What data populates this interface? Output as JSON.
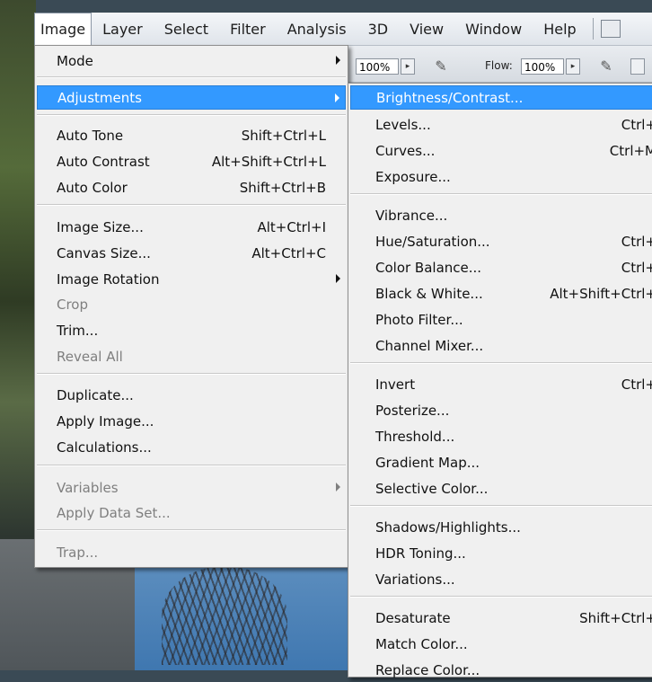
{
  "menubar": {
    "items": [
      "Image",
      "Layer",
      "Select",
      "Filter",
      "Analysis",
      "3D",
      "View",
      "Window",
      "Help"
    ],
    "active": "Image"
  },
  "options_bar": {
    "opacity_value": "100%",
    "flow_label": "Flow:",
    "flow_value": "100%"
  },
  "image_menu": {
    "mode": "Mode",
    "adjustments": "Adjustments",
    "auto_tone": {
      "label": "Auto Tone",
      "shortcut": "Shift+Ctrl+L"
    },
    "auto_contrast": {
      "label": "Auto Contrast",
      "shortcut": "Alt+Shift+Ctrl+L"
    },
    "auto_color": {
      "label": "Auto Color",
      "shortcut": "Shift+Ctrl+B"
    },
    "image_size": {
      "label": "Image Size...",
      "shortcut": "Alt+Ctrl+I"
    },
    "canvas_size": {
      "label": "Canvas Size...",
      "shortcut": "Alt+Ctrl+C"
    },
    "image_rotation": "Image Rotation",
    "crop": "Crop",
    "trim": "Trim...",
    "reveal_all": "Reveal All",
    "duplicate": "Duplicate...",
    "apply_image": "Apply Image...",
    "calculations": "Calculations...",
    "variables": "Variables",
    "apply_data_set": "Apply Data Set...",
    "trap": "Trap..."
  },
  "adjust_menu": {
    "brightness_contrast": "Brightness/Contrast...",
    "levels": {
      "label": "Levels...",
      "shortcut": "Ctrl+"
    },
    "curves": {
      "label": "Curves...",
      "shortcut": "Ctrl+M"
    },
    "exposure": "Exposure...",
    "vibrance": "Vibrance...",
    "hue_saturation": {
      "label": "Hue/Saturation...",
      "shortcut": "Ctrl+"
    },
    "color_balance": {
      "label": "Color Balance...",
      "shortcut": "Ctrl+"
    },
    "black_white": {
      "label": "Black & White...",
      "shortcut": "Alt+Shift+Ctrl+"
    },
    "photo_filter": "Photo Filter...",
    "channel_mixer": "Channel Mixer...",
    "invert": {
      "label": "Invert",
      "shortcut": "Ctrl+"
    },
    "posterize": "Posterize...",
    "threshold": "Threshold...",
    "gradient_map": "Gradient Map...",
    "selective_color": "Selective Color...",
    "shadows_highlights": "Shadows/Highlights...",
    "hdr_toning": "HDR Toning...",
    "variations": "Variations...",
    "desaturate": {
      "label": "Desaturate",
      "shortcut": "Shift+Ctrl+"
    },
    "match_color": "Match Color...",
    "replace_color": "Replace Color..."
  }
}
